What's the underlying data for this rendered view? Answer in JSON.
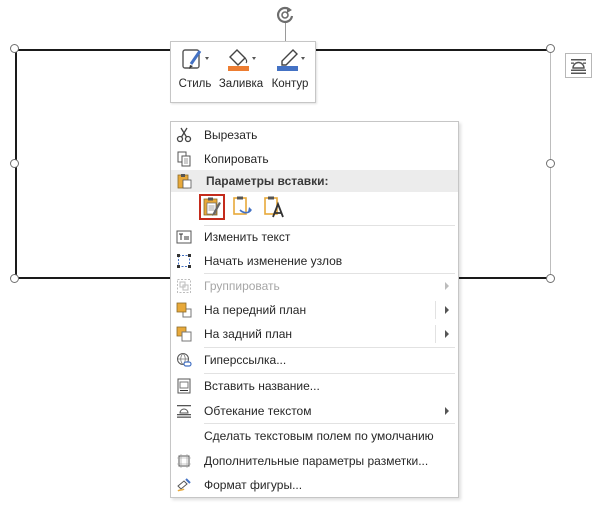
{
  "mini_toolbar": {
    "buttons": [
      {
        "label": "Стиль",
        "icon": "shape-style-icon"
      },
      {
        "label": "Заливка",
        "icon": "paint-bucket-icon"
      },
      {
        "label": "Контур",
        "icon": "pen-outline-icon"
      }
    ]
  },
  "context_menu": {
    "items": [
      {
        "label": "Вырезать",
        "icon": "scissors-icon"
      },
      {
        "label": "Копировать",
        "icon": "copy-icon"
      },
      {
        "label": "Параметры вставки:",
        "header": true
      },
      {
        "label": "Изменить текст",
        "icon": "edit-text-icon"
      },
      {
        "label": "Начать изменение узлов",
        "icon": "edit-points-icon"
      },
      {
        "label": "Группировать",
        "icon": "group-icon",
        "disabled": true,
        "submenu": true
      },
      {
        "label": "На передний план",
        "icon": "bring-front-icon",
        "submenu": true
      },
      {
        "label": "На задний план",
        "icon": "send-back-icon",
        "submenu": true
      },
      {
        "label": "Гиперссылка...",
        "icon": "hyperlink-icon"
      },
      {
        "label": "Вставить название...",
        "icon": "insert-caption-icon"
      },
      {
        "label": "Обтекание текстом",
        "icon": "wrap-text-icon",
        "submenu": true
      },
      {
        "label": "Сделать текстовым полем по умолчанию"
      },
      {
        "label": "Дополнительные параметры разметки...",
        "icon": "layout-options-icon"
      },
      {
        "label": "Формат фигуры...",
        "icon": "format-shape-icon"
      }
    ]
  },
  "colors": {
    "fill_accent": "#ed7d31",
    "outline_accent": "#4472c4",
    "paste_selected_border": "#c42b1c",
    "paste_icon_accent": "#e8a93a"
  }
}
